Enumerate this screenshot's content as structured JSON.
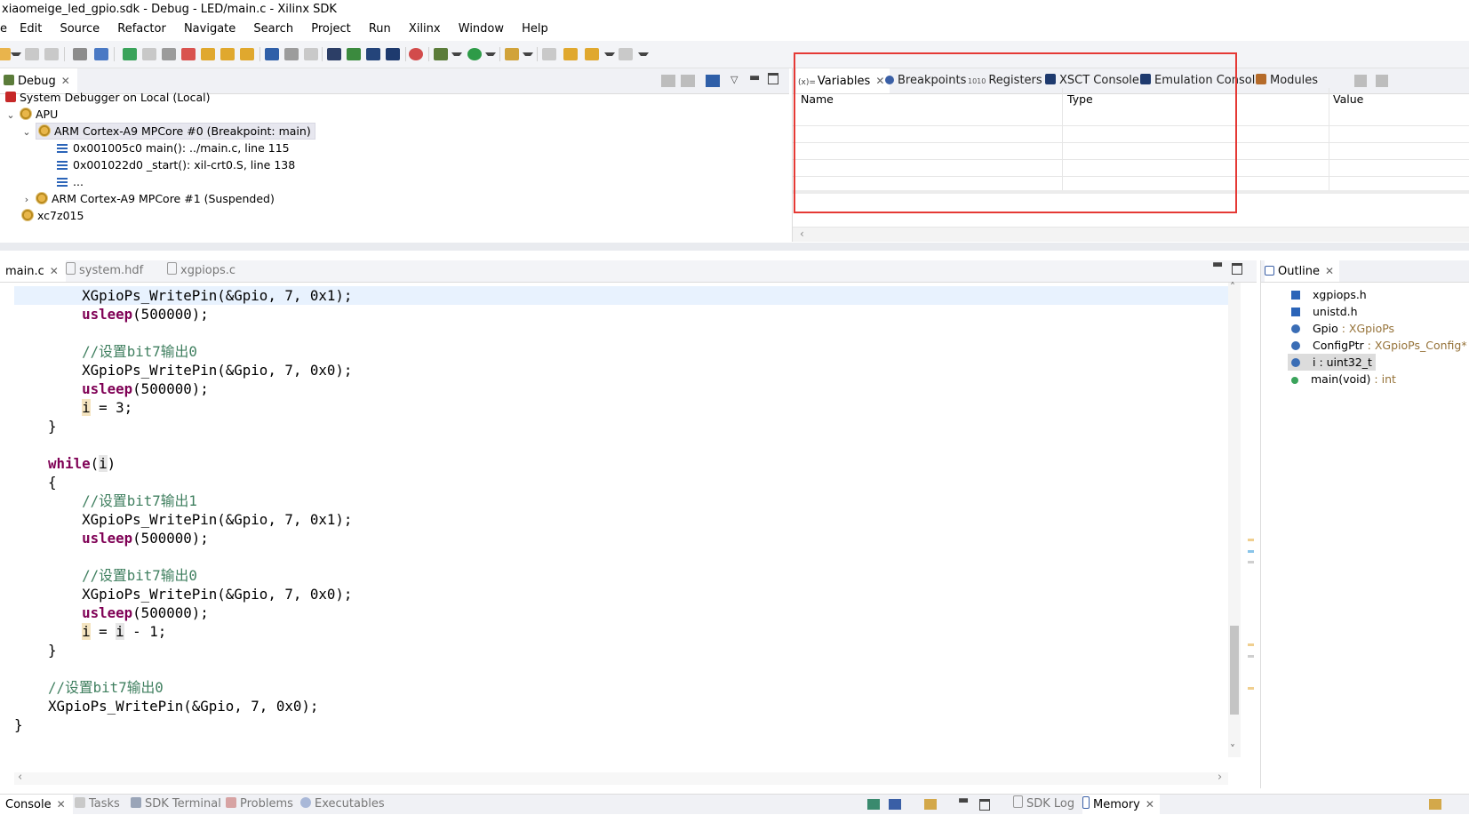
{
  "window": {
    "title": "xiaomeige_led_gpio.sdk - Debug - LED/main.c - Xilinx SDK"
  },
  "menu": [
    "e",
    "Edit",
    "Source",
    "Refactor",
    "Navigate",
    "Search",
    "Project",
    "Run",
    "Xilinx",
    "Window",
    "Help"
  ],
  "debug_view": {
    "tab_label": "Debug",
    "items": [
      {
        "label": "System Debugger on Local (Local)"
      },
      {
        "label": "APU"
      },
      {
        "label": "ARM Cortex-A9 MPCore #0 (Breakpoint: main)"
      },
      {
        "label": "0x001005c0 main(): ../main.c, line 115"
      },
      {
        "label": "0x001022d0 _start(): xil-crt0.S, line 138"
      },
      {
        "label": "..."
      },
      {
        "label": "ARM Cortex-A9 MPCore #1 (Suspended)"
      },
      {
        "label": "xc7z015"
      }
    ]
  },
  "variables_view": {
    "tabs": [
      {
        "label": "Variables",
        "icon": "(x)="
      },
      {
        "label": "Breakpoints"
      },
      {
        "label": "Registers",
        "icon": "1010"
      },
      {
        "label": "XSCT Console"
      },
      {
        "label": "Emulation Console"
      },
      {
        "label": "Modules"
      }
    ],
    "columns": [
      "Name",
      "Type",
      "Value"
    ],
    "highlight_color": "#e53935"
  },
  "editor": {
    "tabs": [
      {
        "label": "main.c"
      },
      {
        "label": "system.hdf"
      },
      {
        "label": "xgpiops.c"
      }
    ]
  },
  "code_lines": [
    "        XGpioPs_WritePin(&Gpio, 7, 0x1);",
    "        usleep(500000);",
    "",
    "        //设置bit7输出0",
    "        XGpioPs_WritePin(&Gpio, 7, 0x0);",
    "        usleep(500000);",
    "        i = 3;",
    "    }",
    "",
    "    while(i)",
    "    {",
    "        //设置bit7输出1",
    "        XGpioPs_WritePin(&Gpio, 7, 0x1);",
    "        usleep(500000);",
    "",
    "        //设置bit7输出0",
    "        XGpioPs_WritePin(&Gpio, 7, 0x0);",
    "        usleep(500000);",
    "        i = i - 1;",
    "    }",
    "",
    "    //设置bit7输出0",
    "    XGpioPs_WritePin(&Gpio, 7, 0x0);",
    "}"
  ],
  "outline": {
    "tab_label": "Outline",
    "items": [
      {
        "name": "xgpiops.h",
        "type": ""
      },
      {
        "name": "unistd.h",
        "type": ""
      },
      {
        "name": "Gpio",
        "type": " : XGpioPs"
      },
      {
        "name": "ConfigPtr",
        "type": " : XGpioPs_Config*"
      },
      {
        "name": "i : uint32_t",
        "type": ""
      },
      {
        "name": "main(void)",
        "type": " : int"
      }
    ]
  },
  "bottom_tabs": [
    {
      "label": "Console"
    },
    {
      "label": "Tasks"
    },
    {
      "label": "SDK Terminal"
    },
    {
      "label": "Problems"
    },
    {
      "label": "Executables"
    }
  ],
  "bottom_right_tabs": [
    {
      "label": "SDK Log"
    },
    {
      "label": "Memory"
    }
  ]
}
